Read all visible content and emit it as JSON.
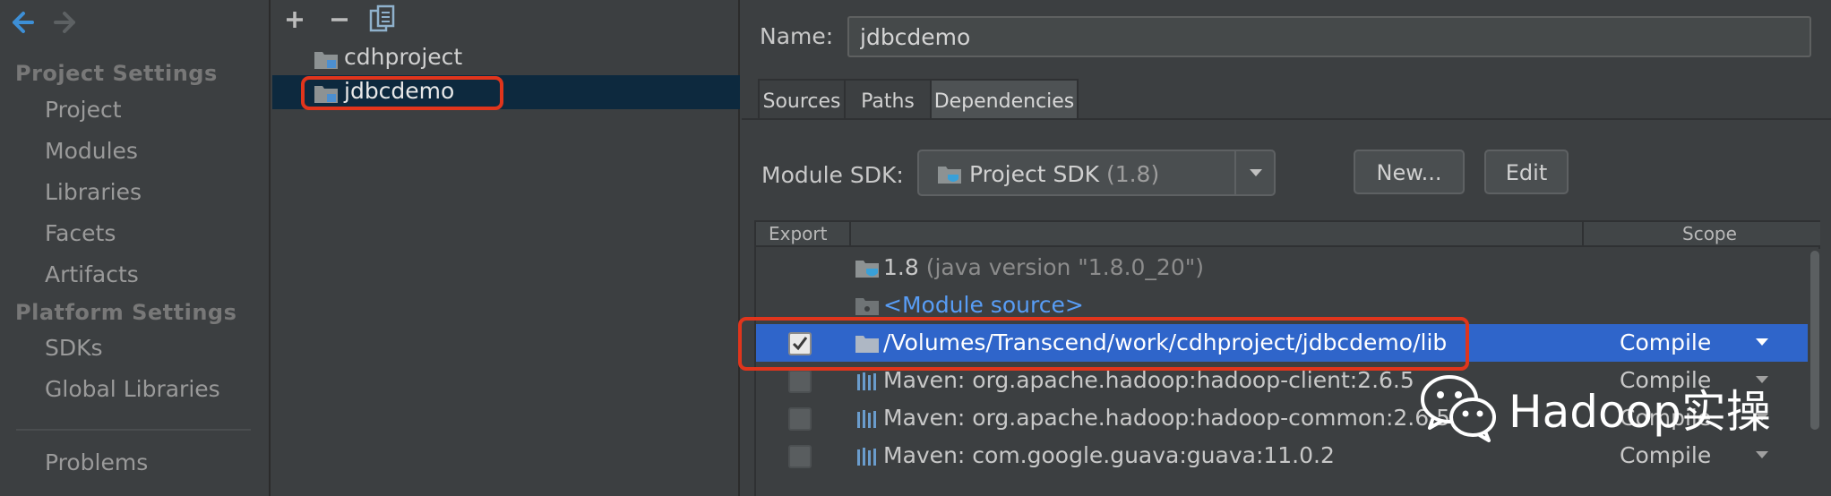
{
  "nav": {
    "back_icon": "arrow-left-icon",
    "forward_icon": "arrow-right-icon",
    "project_settings_heading": "Project Settings",
    "project_settings_items": [
      "Project",
      "Modules",
      "Libraries",
      "Facets",
      "Artifacts"
    ],
    "platform_settings_heading": "Platform Settings",
    "platform_settings_items": [
      "SDKs",
      "Global Libraries"
    ],
    "problems_label": "Problems"
  },
  "tree_toolbar": {
    "add_icon": "plus-icon",
    "remove_icon": "minus-icon",
    "copy_icon": "copy-icon"
  },
  "modules": [
    {
      "name": "cdhproject",
      "selected": false
    },
    {
      "name": "jdbcdemo",
      "selected": true
    }
  ],
  "module_detail": {
    "name_label": "Name:",
    "name_value": "jdbcdemo",
    "tabs": [
      "Sources",
      "Paths",
      "Dependencies"
    ],
    "active_tab": "Dependencies",
    "sdk_label": "Module SDK:",
    "sdk_value": "Project SDK",
    "sdk_version": "(1.8)",
    "new_button": "New...",
    "edit_button": "Edit"
  },
  "dependencies": {
    "columns": {
      "export": "Export",
      "scope": "Scope"
    },
    "rows": [
      {
        "name": "1.8",
        "detail": "(java version \"1.8.0_20\")",
        "icon": "sdk-folder-icon",
        "checkbox": null,
        "scope": ""
      },
      {
        "name": "<Module source>",
        "detail": "",
        "icon": "module-source-icon",
        "checkbox": null,
        "scope": ""
      },
      {
        "name": "/Volumes/Transcend/work/cdhproject/jdbcdemo/lib",
        "detail": "",
        "icon": "folder-icon",
        "checkbox": true,
        "scope": "Compile",
        "selected": true
      },
      {
        "name": "Maven: org.apache.hadoop:hadoop-client:2.6.5",
        "detail": "",
        "icon": "library-icon",
        "checkbox": false,
        "scope": "Compile"
      },
      {
        "name": "Maven: org.apache.hadoop:hadoop-common:2.6.5",
        "detail": "",
        "icon": "library-icon",
        "checkbox": false,
        "scope": "Compile"
      },
      {
        "name": "Maven: com.google.guava:guava:11.0.2",
        "detail": "",
        "icon": "library-icon",
        "checkbox": false,
        "scope": "Compile"
      }
    ]
  },
  "watermark": {
    "text": "Hadoop实操",
    "icon": "wechat-icon"
  },
  "colors": {
    "selection": "#2f65ca",
    "tree_selection": "#0d293e",
    "highlight_box": "#e0351c",
    "link": "#589df6"
  }
}
